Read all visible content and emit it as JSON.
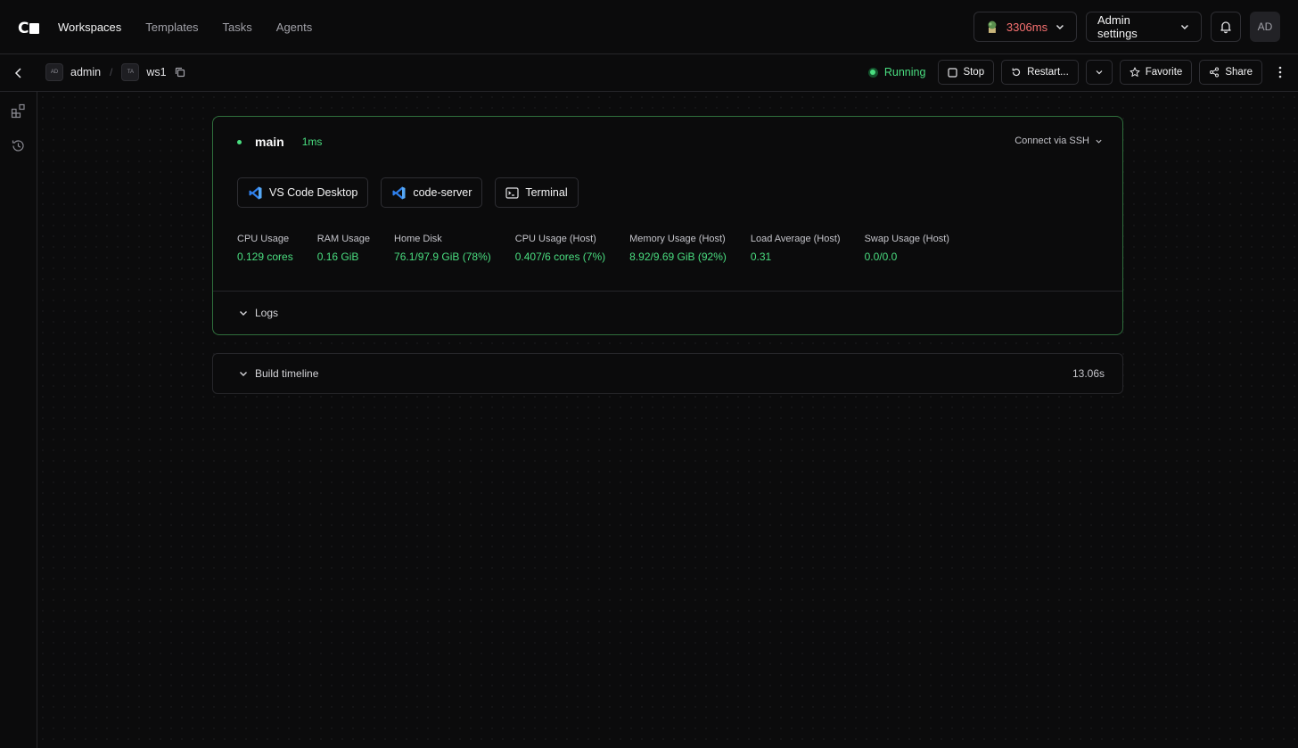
{
  "nav": {
    "items": [
      "Workspaces",
      "Templates",
      "Tasks",
      "Agents"
    ]
  },
  "topbar": {
    "latency": "3306ms",
    "admin_settings": "Admin settings",
    "avatar_initials": "AD"
  },
  "breadcrumb": {
    "owner_initials": "AD",
    "owner": "admin",
    "separator": "/",
    "workspace_initials": "TA",
    "workspace": "ws1"
  },
  "workspace_actions": {
    "status": "Running",
    "stop": "Stop",
    "restart": "Restart...",
    "favorite": "Favorite",
    "share": "Share"
  },
  "agent": {
    "name": "main",
    "latency": "1ms",
    "connect_ssh": "Connect via SSH",
    "apps": [
      "VS Code Desktop",
      "code-server",
      "Terminal"
    ],
    "stats": [
      {
        "label": "CPU Usage",
        "value": "0.129 cores"
      },
      {
        "label": "RAM Usage",
        "value": "0.16 GiB"
      },
      {
        "label": "Home Disk",
        "value": "76.1/97.9 GiB (78%)"
      },
      {
        "label": "CPU Usage (Host)",
        "value": "0.407/6 cores (7%)"
      },
      {
        "label": "Memory Usage (Host)",
        "value": "8.92/9.69 GiB (92%)"
      },
      {
        "label": "Load Average (Host)",
        "value": "0.31"
      },
      {
        "label": "Swap Usage (Host)",
        "value": "0.0/0.0"
      }
    ],
    "logs_label": "Logs"
  },
  "build_timeline": {
    "label": "Build timeline",
    "duration": "13.06s"
  },
  "colors": {
    "accent_green": "#4ade80",
    "latency_red": "#f87171",
    "card_border_green": "#2f6f3c",
    "background": "#0b0b0c"
  }
}
